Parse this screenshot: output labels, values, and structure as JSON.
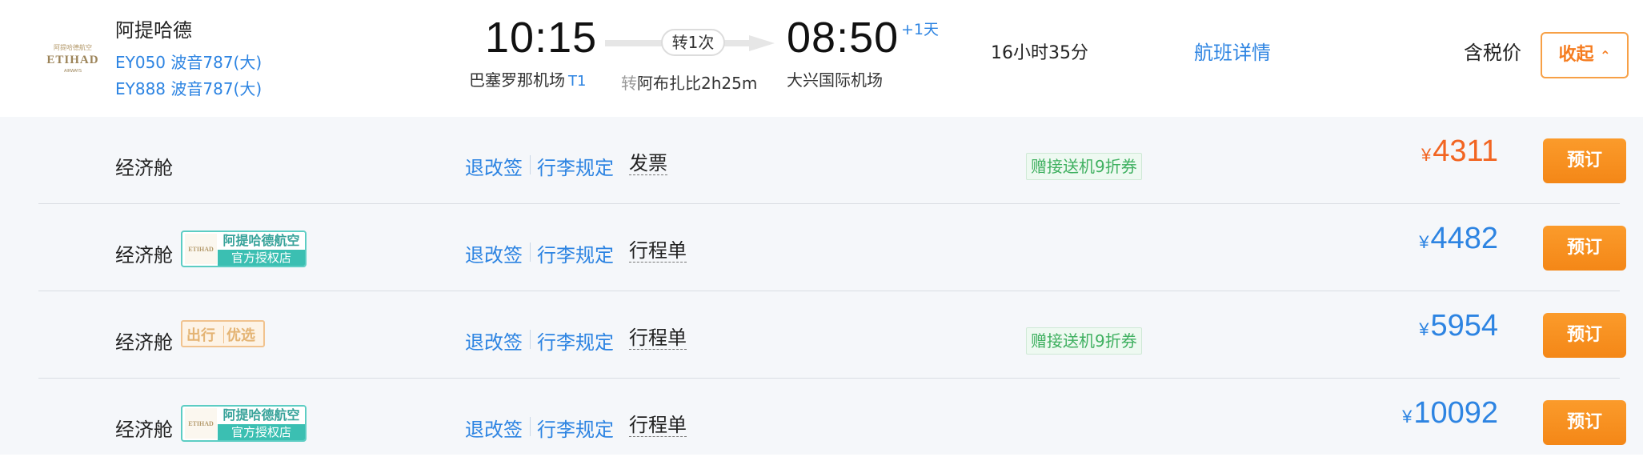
{
  "flight": {
    "airline": "阿提哈德",
    "logo_text": {
      "cn": "阿提哈德航空",
      "en": "ETIHAD",
      "sub": "AIRWAYS"
    },
    "flight_numbers": [
      "EY050 波音787(大)",
      "EY888 波音787(大)"
    ],
    "departure": {
      "time": "10:15",
      "airport": "巴塞罗那机场",
      "terminal": "T1"
    },
    "transfer": {
      "count_label": "转1次",
      "prefix": "转",
      "info": "阿布扎比2h25m"
    },
    "arrival": {
      "time": "08:50",
      "day_offset": "+1天",
      "airport": "大兴国际机场"
    },
    "duration": "16小时35分",
    "detail_link": "航班详情",
    "tax_label": "含税价",
    "collapse_button": "收起"
  },
  "fares": [
    {
      "cabin": "经济舱",
      "badge": "",
      "refund_label": "退改签",
      "baggage_label": "行李规定",
      "doc_label": "发票",
      "promo": "赠接送机9折券",
      "currency": "¥",
      "price": "4311",
      "price_color": "#f26522",
      "book_label": "预订"
    },
    {
      "cabin": "经济舱",
      "badge": "official",
      "badge_top": "阿提哈德航空",
      "badge_bottom": "官方授权店",
      "refund_label": "退改签",
      "baggage_label": "行李规定",
      "doc_label": "行程单",
      "promo": "",
      "currency": "¥",
      "price": "4482",
      "price_color": "#2d84e2",
      "book_label": "预订"
    },
    {
      "cabin": "经济舱",
      "badge": "prefer",
      "badge_left": "出行",
      "badge_right": "优选",
      "refund_label": "退改签",
      "baggage_label": "行李规定",
      "doc_label": "行程单",
      "promo": "赠接送机9折券",
      "currency": "¥",
      "price": "5954",
      "price_color": "#2d84e2",
      "book_label": "预订"
    },
    {
      "cabin": "经济舱",
      "badge": "official",
      "badge_top": "阿提哈德航空",
      "badge_bottom": "官方授权店",
      "refund_label": "退改签",
      "baggage_label": "行李规定",
      "doc_label": "行程单",
      "promo": "",
      "currency": "¥",
      "price": "10092",
      "price_color": "#2d84e2",
      "book_label": "预订"
    }
  ],
  "colors": {
    "link": "#2d84e2",
    "accent": "#f48717",
    "price_highlight": "#f26522",
    "promo": "#3fb060",
    "official_badge": "#3bbfb2"
  }
}
